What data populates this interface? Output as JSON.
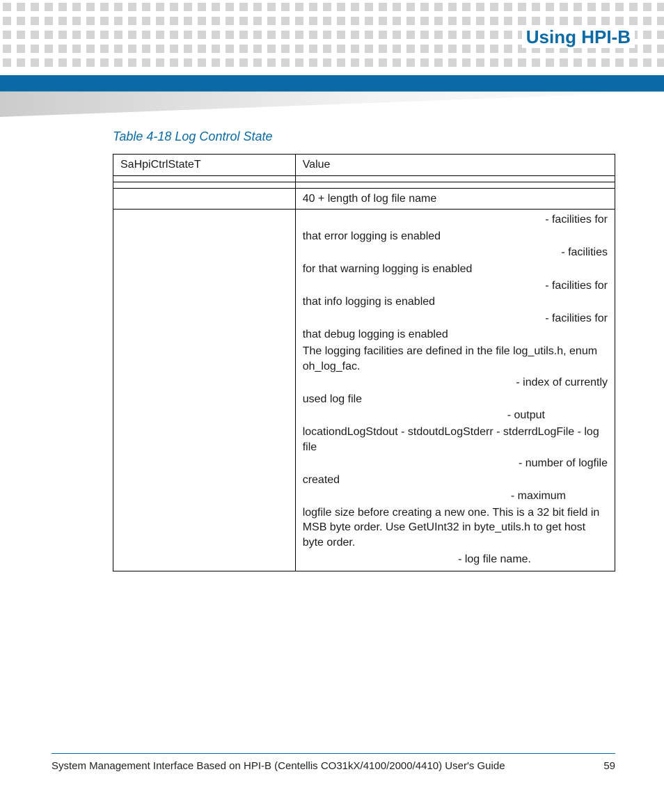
{
  "header": {
    "title": "Using HPI-B"
  },
  "table": {
    "caption": "Table 4-18 Log Control State",
    "headers": {
      "c1": "SaHpiCtrlStateT",
      "c2": "Value"
    },
    "row_blank1": {
      "c1": "",
      "c2": ""
    },
    "row_blank2": {
      "c1": "",
      "c2": ""
    },
    "row_len": {
      "c1": "",
      "c2": "40  + length of log file name"
    },
    "big": {
      "l1": "- facilities for that error logging is enabled",
      "l2": "- facilities for that warning logging is enabled",
      "l3": "- facilities for that info logging is enabled",
      "l4": "- facilities for that debug logging is enabled",
      "l5": "The logging facilities are defined in the file log_utils.h, enum oh_log_fac.",
      "l6": "- index of currently used log file",
      "l7": "- output locationdLogStdout - stdoutdLogStderr - stderrdLogFile - log file",
      "l8": "- number of logfile created",
      "l9": "- maximum logfile size before creating a new one. This is a 32 bit field in MSB byte order. Use GetUInt32 in byte_utils.h to get host byte order.",
      "l10": "- log file name."
    }
  },
  "footer": {
    "text": "System Management Interface Based on HPI-B (Centellis CO31kX/4100/2000/4410) User's Guide",
    "page": "59"
  }
}
